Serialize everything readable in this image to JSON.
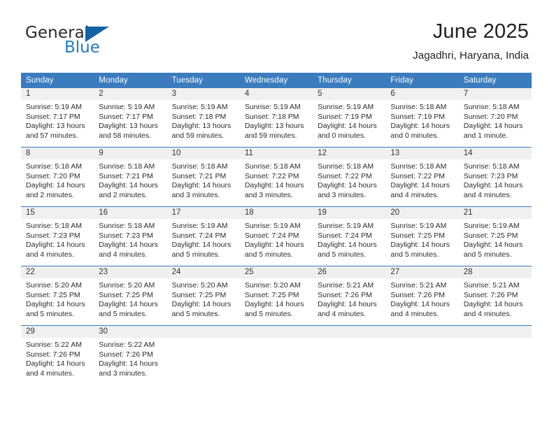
{
  "logo": {
    "word_top": "General",
    "word_bottom": "Blue",
    "triangle_icon": "triangle-icon",
    "colors": {
      "dark": "#2b2b2b",
      "blue": "#1e7bc4",
      "triangle": "#1362a6"
    }
  },
  "header": {
    "title": "June 2025",
    "subtitle": "Jagadhri, Haryana, India"
  },
  "theme": {
    "header_blue": "#3a7cbe",
    "daynum_gray": "#f0f0f0",
    "text": "#2d2d2d"
  },
  "calendar": {
    "weekday_headers": [
      "Sunday",
      "Monday",
      "Tuesday",
      "Wednesday",
      "Thursday",
      "Friday",
      "Saturday"
    ],
    "weeks": [
      [
        {
          "day": "1",
          "sunrise": "Sunrise: 5:19 AM",
          "sunset": "Sunset: 7:17 PM",
          "daylight_1": "Daylight: 13 hours",
          "daylight_2": "and 57 minutes."
        },
        {
          "day": "2",
          "sunrise": "Sunrise: 5:19 AM",
          "sunset": "Sunset: 7:17 PM",
          "daylight_1": "Daylight: 13 hours",
          "daylight_2": "and 58 minutes."
        },
        {
          "day": "3",
          "sunrise": "Sunrise: 5:19 AM",
          "sunset": "Sunset: 7:18 PM",
          "daylight_1": "Daylight: 13 hours",
          "daylight_2": "and 59 minutes."
        },
        {
          "day": "4",
          "sunrise": "Sunrise: 5:19 AM",
          "sunset": "Sunset: 7:18 PM",
          "daylight_1": "Daylight: 13 hours",
          "daylight_2": "and 59 minutes."
        },
        {
          "day": "5",
          "sunrise": "Sunrise: 5:19 AM",
          "sunset": "Sunset: 7:19 PM",
          "daylight_1": "Daylight: 14 hours",
          "daylight_2": "and 0 minutes."
        },
        {
          "day": "6",
          "sunrise": "Sunrise: 5:18 AM",
          "sunset": "Sunset: 7:19 PM",
          "daylight_1": "Daylight: 14 hours",
          "daylight_2": "and 0 minutes."
        },
        {
          "day": "7",
          "sunrise": "Sunrise: 5:18 AM",
          "sunset": "Sunset: 7:20 PM",
          "daylight_1": "Daylight: 14 hours",
          "daylight_2": "and 1 minute."
        }
      ],
      [
        {
          "day": "8",
          "sunrise": "Sunrise: 5:18 AM",
          "sunset": "Sunset: 7:20 PM",
          "daylight_1": "Daylight: 14 hours",
          "daylight_2": "and 2 minutes."
        },
        {
          "day": "9",
          "sunrise": "Sunrise: 5:18 AM",
          "sunset": "Sunset: 7:21 PM",
          "daylight_1": "Daylight: 14 hours",
          "daylight_2": "and 2 minutes."
        },
        {
          "day": "10",
          "sunrise": "Sunrise: 5:18 AM",
          "sunset": "Sunset: 7:21 PM",
          "daylight_1": "Daylight: 14 hours",
          "daylight_2": "and 3 minutes."
        },
        {
          "day": "11",
          "sunrise": "Sunrise: 5:18 AM",
          "sunset": "Sunset: 7:22 PM",
          "daylight_1": "Daylight: 14 hours",
          "daylight_2": "and 3 minutes."
        },
        {
          "day": "12",
          "sunrise": "Sunrise: 5:18 AM",
          "sunset": "Sunset: 7:22 PM",
          "daylight_1": "Daylight: 14 hours",
          "daylight_2": "and 3 minutes."
        },
        {
          "day": "13",
          "sunrise": "Sunrise: 5:18 AM",
          "sunset": "Sunset: 7:22 PM",
          "daylight_1": "Daylight: 14 hours",
          "daylight_2": "and 4 minutes."
        },
        {
          "day": "14",
          "sunrise": "Sunrise: 5:18 AM",
          "sunset": "Sunset: 7:23 PM",
          "daylight_1": "Daylight: 14 hours",
          "daylight_2": "and 4 minutes."
        }
      ],
      [
        {
          "day": "15",
          "sunrise": "Sunrise: 5:18 AM",
          "sunset": "Sunset: 7:23 PM",
          "daylight_1": "Daylight: 14 hours",
          "daylight_2": "and 4 minutes."
        },
        {
          "day": "16",
          "sunrise": "Sunrise: 5:18 AM",
          "sunset": "Sunset: 7:23 PM",
          "daylight_1": "Daylight: 14 hours",
          "daylight_2": "and 4 minutes."
        },
        {
          "day": "17",
          "sunrise": "Sunrise: 5:19 AM",
          "sunset": "Sunset: 7:24 PM",
          "daylight_1": "Daylight: 14 hours",
          "daylight_2": "and 5 minutes."
        },
        {
          "day": "18",
          "sunrise": "Sunrise: 5:19 AM",
          "sunset": "Sunset: 7:24 PM",
          "daylight_1": "Daylight: 14 hours",
          "daylight_2": "and 5 minutes."
        },
        {
          "day": "19",
          "sunrise": "Sunrise: 5:19 AM",
          "sunset": "Sunset: 7:24 PM",
          "daylight_1": "Daylight: 14 hours",
          "daylight_2": "and 5 minutes."
        },
        {
          "day": "20",
          "sunrise": "Sunrise: 5:19 AM",
          "sunset": "Sunset: 7:25 PM",
          "daylight_1": "Daylight: 14 hours",
          "daylight_2": "and 5 minutes."
        },
        {
          "day": "21",
          "sunrise": "Sunrise: 5:19 AM",
          "sunset": "Sunset: 7:25 PM",
          "daylight_1": "Daylight: 14 hours",
          "daylight_2": "and 5 minutes."
        }
      ],
      [
        {
          "day": "22",
          "sunrise": "Sunrise: 5:20 AM",
          "sunset": "Sunset: 7:25 PM",
          "daylight_1": "Daylight: 14 hours",
          "daylight_2": "and 5 minutes."
        },
        {
          "day": "23",
          "sunrise": "Sunrise: 5:20 AM",
          "sunset": "Sunset: 7:25 PM",
          "daylight_1": "Daylight: 14 hours",
          "daylight_2": "and 5 minutes."
        },
        {
          "day": "24",
          "sunrise": "Sunrise: 5:20 AM",
          "sunset": "Sunset: 7:25 PM",
          "daylight_1": "Daylight: 14 hours",
          "daylight_2": "and 5 minutes."
        },
        {
          "day": "25",
          "sunrise": "Sunrise: 5:20 AM",
          "sunset": "Sunset: 7:25 PM",
          "daylight_1": "Daylight: 14 hours",
          "daylight_2": "and 5 minutes."
        },
        {
          "day": "26",
          "sunrise": "Sunrise: 5:21 AM",
          "sunset": "Sunset: 7:26 PM",
          "daylight_1": "Daylight: 14 hours",
          "daylight_2": "and 4 minutes."
        },
        {
          "day": "27",
          "sunrise": "Sunrise: 5:21 AM",
          "sunset": "Sunset: 7:26 PM",
          "daylight_1": "Daylight: 14 hours",
          "daylight_2": "and 4 minutes."
        },
        {
          "day": "28",
          "sunrise": "Sunrise: 5:21 AM",
          "sunset": "Sunset: 7:26 PM",
          "daylight_1": "Daylight: 14 hours",
          "daylight_2": "and 4 minutes."
        }
      ],
      [
        {
          "day": "29",
          "sunrise": "Sunrise: 5:22 AM",
          "sunset": "Sunset: 7:26 PM",
          "daylight_1": "Daylight: 14 hours",
          "daylight_2": "and 4 minutes."
        },
        {
          "day": "30",
          "sunrise": "Sunrise: 5:22 AM",
          "sunset": "Sunset: 7:26 PM",
          "daylight_1": "Daylight: 14 hours",
          "daylight_2": "and 3 minutes."
        },
        {
          "day": "",
          "sunrise": "",
          "sunset": "",
          "daylight_1": "",
          "daylight_2": ""
        },
        {
          "day": "",
          "sunrise": "",
          "sunset": "",
          "daylight_1": "",
          "daylight_2": ""
        },
        {
          "day": "",
          "sunrise": "",
          "sunset": "",
          "daylight_1": "",
          "daylight_2": ""
        },
        {
          "day": "",
          "sunrise": "",
          "sunset": "",
          "daylight_1": "",
          "daylight_2": ""
        },
        {
          "day": "",
          "sunrise": "",
          "sunset": "",
          "daylight_1": "",
          "daylight_2": ""
        }
      ]
    ]
  }
}
